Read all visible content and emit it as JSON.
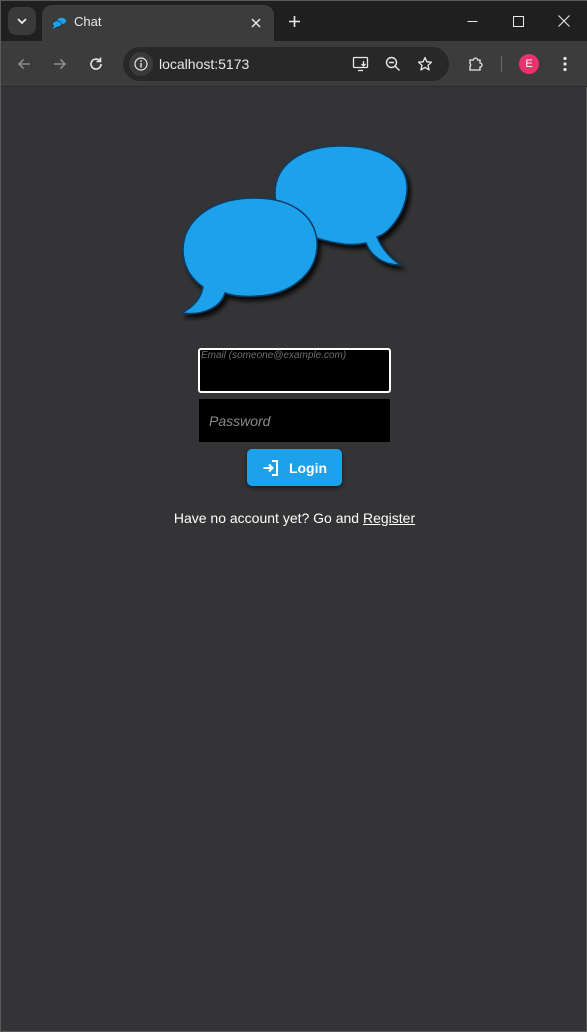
{
  "browser": {
    "tab_title": "Chat",
    "url": "localhost:5173",
    "profile_initial": "E",
    "icons": {
      "tab_search": "chevron-down-icon",
      "tab_close": "close-icon",
      "new_tab": "plus-icon",
      "minimize": "minimize-icon",
      "maximize": "maximize-icon",
      "close_window": "close-icon",
      "back": "arrow-left-icon",
      "forward": "arrow-right-icon",
      "reload": "reload-icon",
      "site_info": "info-icon",
      "install_app": "install-app-icon",
      "zoom": "zoom-out-icon",
      "bookmark": "star-icon",
      "extensions": "puzzle-icon",
      "menu": "kebab-menu-icon"
    }
  },
  "login": {
    "email_placeholder": "Email (someone@example.com)",
    "password_placeholder": "Password",
    "login_label": "Login",
    "register_prompt": "Have no account yet? Go and ",
    "register_link": "Register"
  },
  "colors": {
    "background": "#343436",
    "accent": "#1ca1ea",
    "avatar": "#e8336b"
  }
}
